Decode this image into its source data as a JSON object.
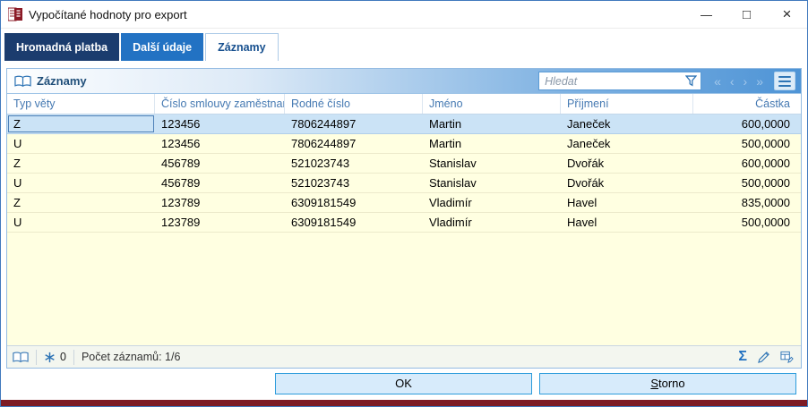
{
  "window": {
    "title": "Vypočítané hodnoty pro export",
    "controls": {
      "minimize": "—",
      "maximize": "□",
      "close": "×"
    }
  },
  "tabs": [
    {
      "label": "Hromadná platba",
      "active": false
    },
    {
      "label": "Další údaje",
      "active": false
    },
    {
      "label": "Záznamy",
      "active": true
    }
  ],
  "panel": {
    "title": "Záznamy",
    "search_placeholder": "Hledat",
    "nav_glyphs": [
      "«",
      "‹",
      "›",
      "»"
    ],
    "icons": [
      "book-icon",
      "filter-funnel-icon",
      "menu-icon"
    ]
  },
  "table": {
    "columns": [
      "Typ věty",
      "Číslo smlouvy zaměstnance",
      "Rodné číslo",
      "Jméno",
      "Příjmení",
      "Částka"
    ],
    "rows": [
      [
        "Z",
        "123456",
        "7806244897",
        "Martin",
        "Janeček",
        "600,0000"
      ],
      [
        "U",
        "123456",
        "7806244897",
        "Martin",
        "Janeček",
        "500,0000"
      ],
      [
        "Z",
        "456789",
        "521023743",
        "Stanislav",
        "Dvořák",
        "600,0000"
      ],
      [
        "U",
        "456789",
        "521023743",
        "Stanislav",
        "Dvořák",
        "500,0000"
      ],
      [
        "Z",
        "123789",
        "6309181549",
        "Vladimír",
        "Havel",
        "835,0000"
      ],
      [
        "U",
        "123789",
        "6309181549",
        "Vladimír",
        "Havel",
        "500,0000"
      ]
    ],
    "selected_row": 0
  },
  "statusbar": {
    "asterisk_count": "0",
    "record_count": "Počet záznamů: 1/6",
    "sigma": "Σ",
    "icons": [
      "book-icon",
      "asterisk-icon",
      "sum-icon",
      "pencil-icon",
      "export-grid-icon"
    ]
  },
  "footer": {
    "ok": "OK",
    "storno": "Storno"
  },
  "colors": {
    "accent_blue": "#2E74B5",
    "tab_dark": "#1B3C6E",
    "tab_mid": "#2272C3",
    "table_bg": "#FFFFE1",
    "selection_bg": "#CBE3F6",
    "button_bg": "#D7EBFB",
    "button_border": "#2D9CDB",
    "bottom_bar": "#7D1B25"
  }
}
